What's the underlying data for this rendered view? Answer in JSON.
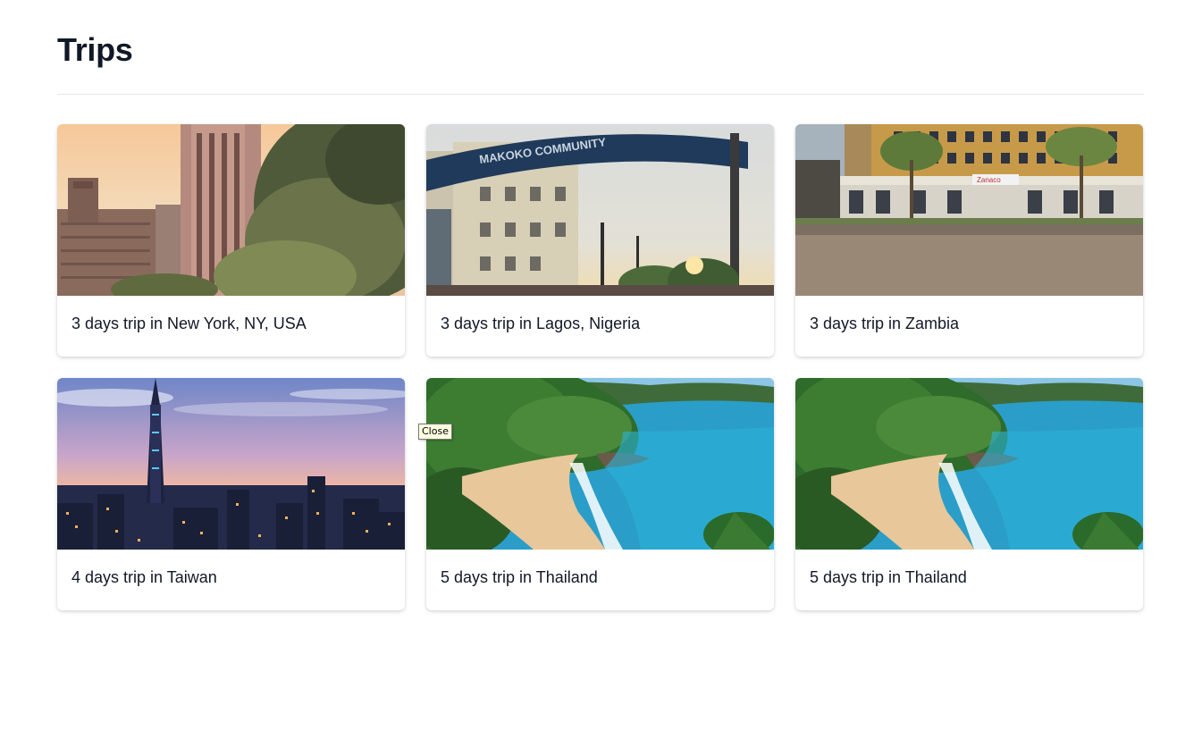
{
  "page": {
    "title": "Trips"
  },
  "trips": [
    {
      "title": "3 days trip in New York, NY, USA"
    },
    {
      "title": "3 days trip in Lagos, Nigeria"
    },
    {
      "title": "3 days trip in Zambia"
    },
    {
      "title": "4 days trip in Taiwan"
    },
    {
      "title": "5 days trip in Thailand"
    },
    {
      "title": "5 days trip in Thailand"
    }
  ],
  "tooltip": {
    "text": "Close"
  },
  "overlay_text": {
    "lagos_sign": "MAKOKO COMMUNITY",
    "zambia_sign": "Zanaco"
  }
}
